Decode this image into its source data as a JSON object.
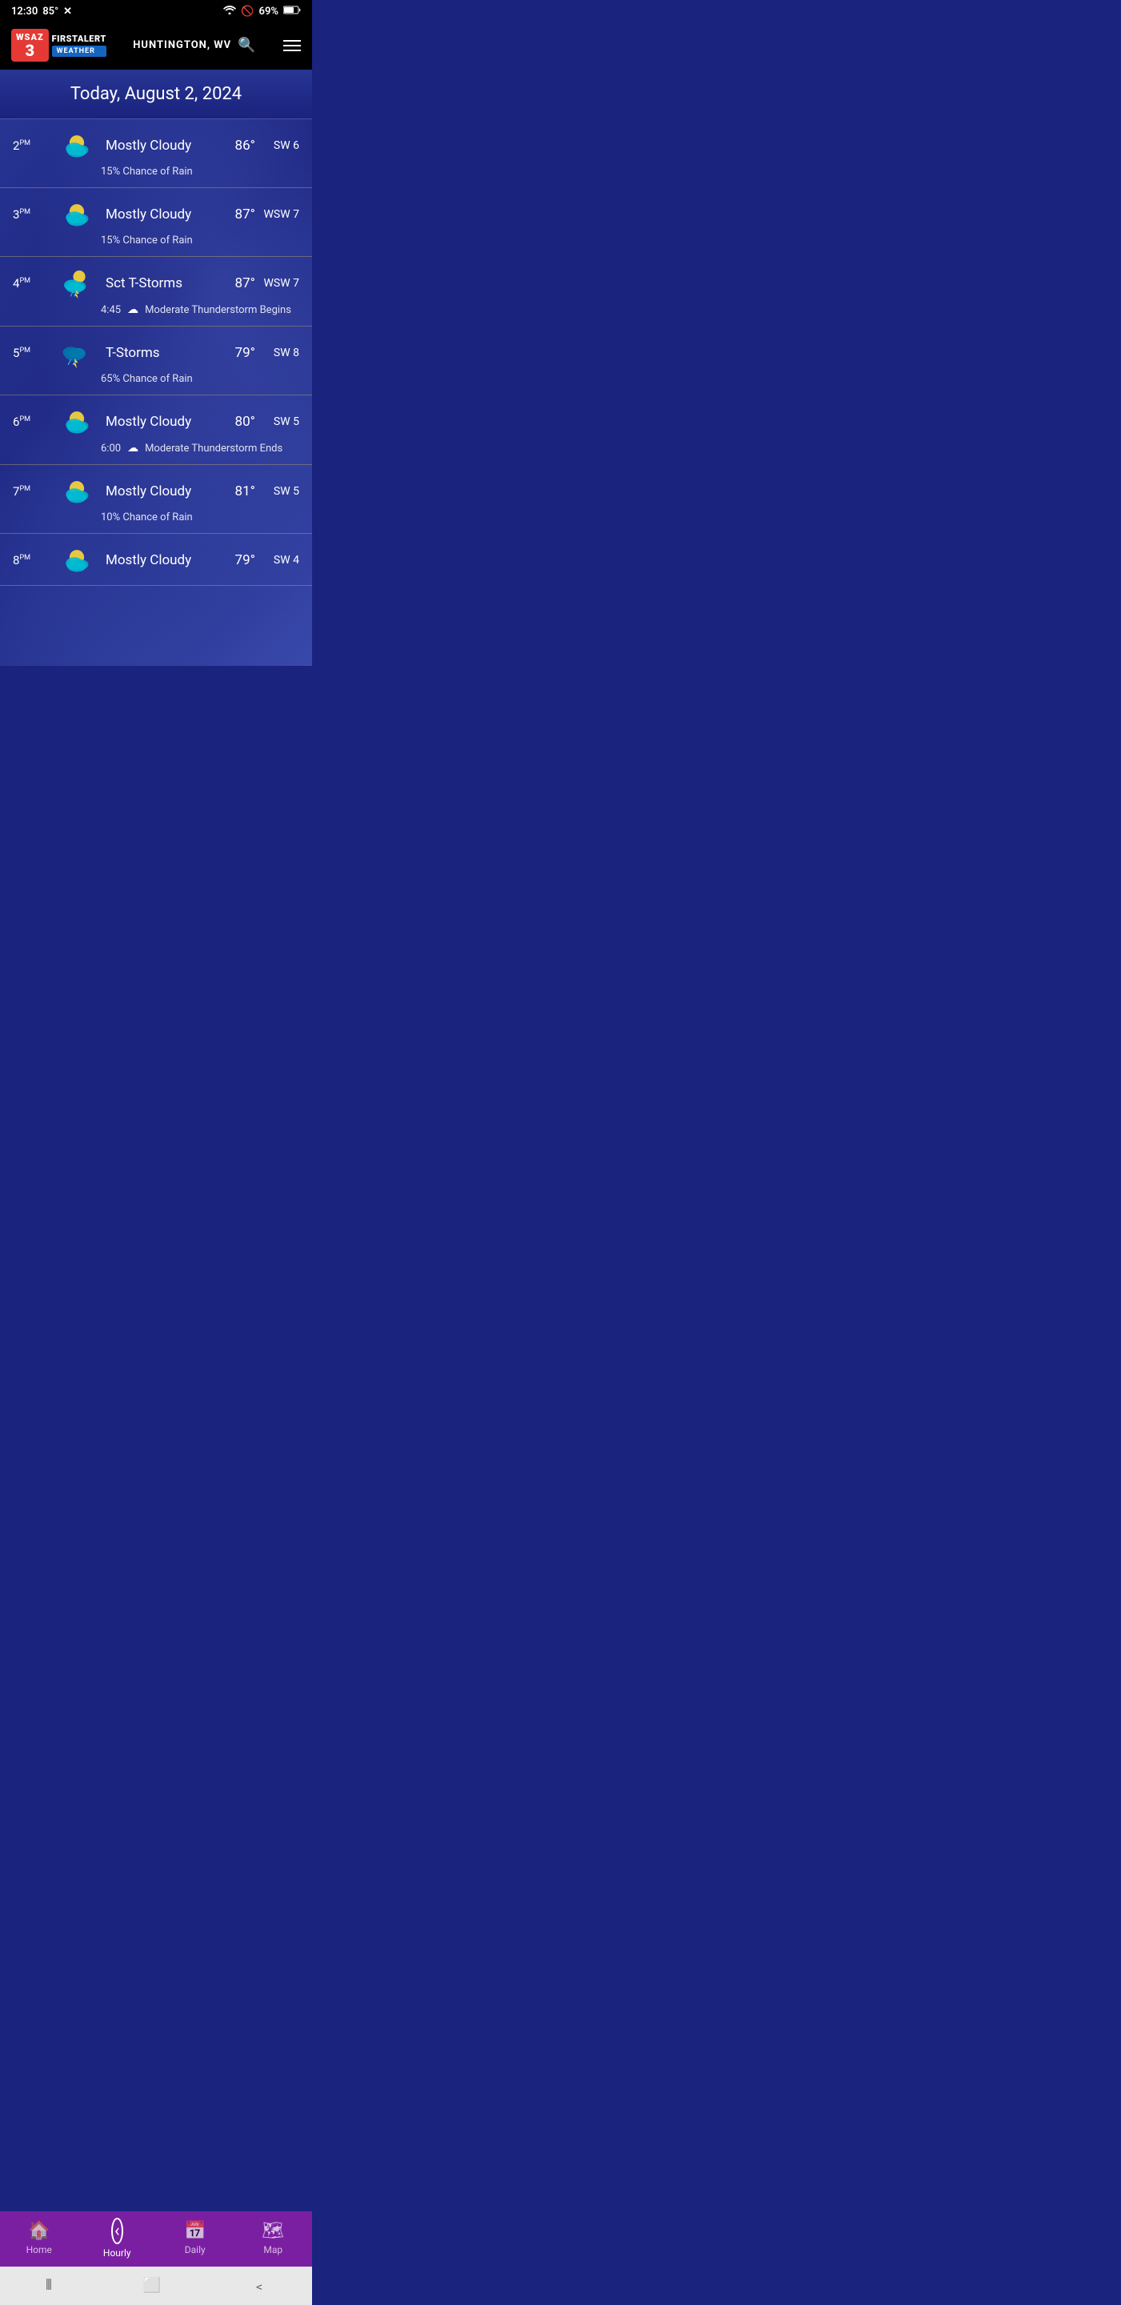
{
  "status_bar": {
    "time": "12:30",
    "temp": "85°",
    "battery": "69%"
  },
  "header": {
    "location": "HUNTINGTON, WV",
    "logo_wsaz": "WSAZ",
    "logo_num": "3",
    "logo_first_alert": "FIRSTALERT",
    "logo_weather": "WEATHER"
  },
  "date_banner": {
    "text": "Today, August 2, 2024"
  },
  "hourly": [
    {
      "time": "2",
      "period": "PM",
      "condition": "Mostly Cloudy",
      "temp": "86°",
      "wind": "SW 6",
      "sub_text": "15% Chance of Rain",
      "sub_time": "",
      "sub_alert": "",
      "icon_type": "mostly_cloudy_sun"
    },
    {
      "time": "3",
      "period": "PM",
      "condition": "Mostly Cloudy",
      "temp": "87°",
      "wind": "WSW 7",
      "sub_text": "15% Chance of Rain",
      "sub_time": "",
      "sub_alert": "",
      "icon_type": "mostly_cloudy_sun"
    },
    {
      "time": "4",
      "period": "PM",
      "condition": "Sct T-Storms",
      "temp": "87°",
      "wind": "WSW 7",
      "sub_text": "Moderate Thunderstorm Begins",
      "sub_time": "4:45",
      "sub_alert": "⛈",
      "icon_type": "tstorm_sun"
    },
    {
      "time": "5",
      "period": "PM",
      "condition": "T-Storms",
      "temp": "79°",
      "wind": "SW 8",
      "sub_text": "65% Chance of Rain",
      "sub_time": "",
      "sub_alert": "",
      "icon_type": "tstorm"
    },
    {
      "time": "6",
      "period": "PM",
      "condition": "Mostly Cloudy",
      "temp": "80°",
      "wind": "SW 5",
      "sub_text": "Moderate Thunderstorm Ends",
      "sub_time": "6:00",
      "sub_alert": "⛈",
      "icon_type": "mostly_cloudy_sun"
    },
    {
      "time": "7",
      "period": "PM",
      "condition": "Mostly Cloudy",
      "temp": "81°",
      "wind": "SW 5",
      "sub_text": "10% Chance of Rain",
      "sub_time": "",
      "sub_alert": "",
      "icon_type": "mostly_cloudy_sun"
    },
    {
      "time": "8",
      "period": "PM",
      "condition": "Mostly Cloudy",
      "temp": "79°",
      "wind": "SW 4",
      "sub_text": "",
      "sub_time": "",
      "sub_alert": "",
      "icon_type": "mostly_cloudy_sun"
    }
  ],
  "nav": {
    "home": "Home",
    "hourly": "Hourly",
    "daily": "Daily",
    "map": "Map"
  }
}
